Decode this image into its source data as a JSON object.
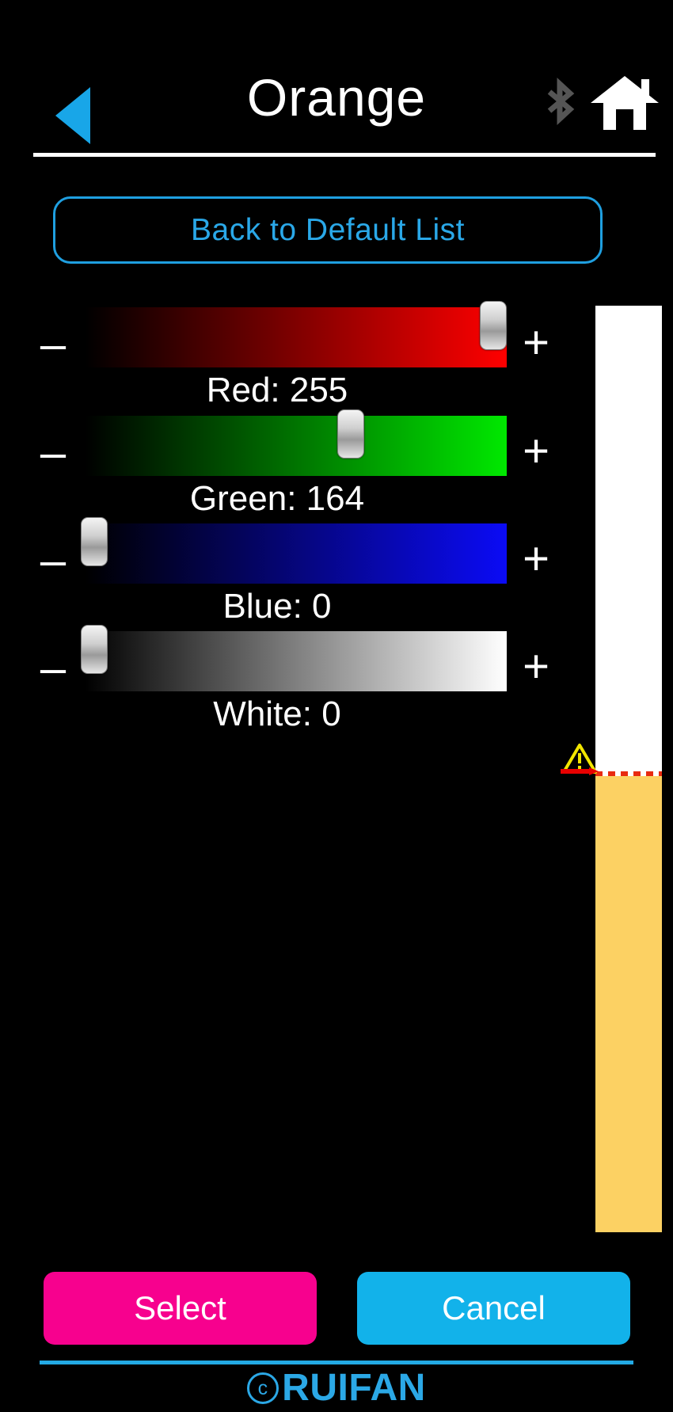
{
  "header": {
    "title": "Orange",
    "back_icon": "back-triangle-icon",
    "bluetooth_icon": "bluetooth-icon",
    "bluetooth_state": "inactive",
    "home_icon": "home-icon",
    "bluetooth_color": "#555555",
    "home_color": "#ffffff",
    "accent_color": "#18a6e8"
  },
  "default_button": {
    "label": "Back to Default List",
    "border_color": "#1f9fe0",
    "text_color": "#2aa8e8"
  },
  "sliders": [
    {
      "channel": "Red",
      "label": "Red: 255",
      "value": 255,
      "max": 255,
      "percent": 100,
      "minus_label": "–",
      "plus_label": "+",
      "track_end_color": "#ff0000"
    },
    {
      "channel": "Green",
      "label": "Green: 164",
      "value": 164,
      "max": 255,
      "percent": 64,
      "minus_label": "–",
      "plus_label": "+",
      "track_end_color": "#00e800"
    },
    {
      "channel": "Blue",
      "label": "Blue: 0",
      "value": 0,
      "max": 255,
      "percent": 0,
      "minus_label": "–",
      "plus_label": "+",
      "track_end_color": "#0b0bf5"
    },
    {
      "channel": "White",
      "label": "White: 0",
      "value": 0,
      "max": 255,
      "percent": 0,
      "minus_label": "–",
      "plus_label": "+",
      "track_end_color": "#ffffff"
    }
  ],
  "preview": {
    "top_color": "#ffffff",
    "bottom_color": "#fcd163",
    "marker_color": "#e82a10",
    "warning_icon": "warning-triangle-icon",
    "warning_color": "#f2e600",
    "arrow_icon": "red-arrow-icon"
  },
  "actions": {
    "select_label": "Select",
    "select_color": "#f7018e",
    "cancel_label": "Cancel",
    "cancel_color": "#12b2ea"
  },
  "footer": {
    "copyright_mark": "c",
    "brand": "RUIFAN",
    "color": "#2ba8e6"
  }
}
